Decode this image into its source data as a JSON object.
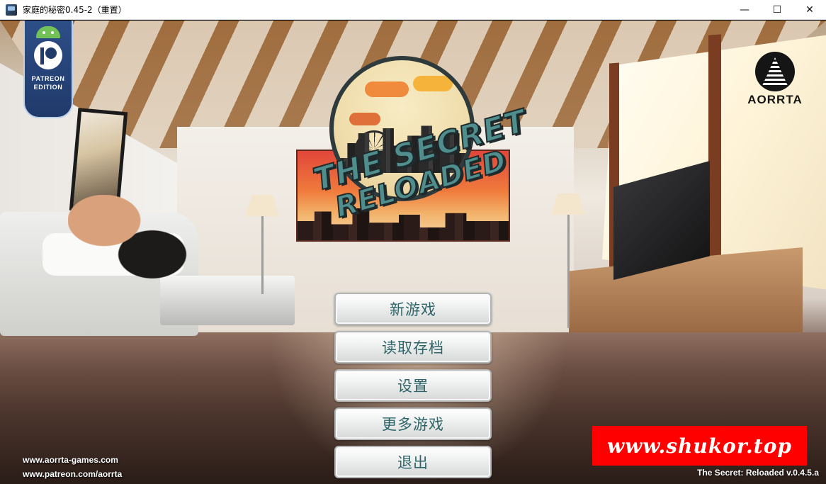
{
  "window": {
    "title": "家庭的秘密0.45-2（重置）",
    "controls": {
      "minimize": "—",
      "maximize": "☐",
      "close": "✕"
    }
  },
  "badges": {
    "patreon_line1": "PATREON",
    "patreon_line2": "EDITION",
    "publisher": "AORRTA"
  },
  "logo": {
    "line1": "THE SECRET",
    "line2": "RELOADED"
  },
  "menu": {
    "items": [
      {
        "label": "新游戏"
      },
      {
        "label": "读取存档"
      },
      {
        "label": "设置"
      },
      {
        "label": "更多游戏"
      },
      {
        "label": "退出"
      }
    ]
  },
  "footer": {
    "site1": "www.aorrta-games.com",
    "site2": "www.patreon.com/aorrta",
    "watermark": "www.shukor.top",
    "version": "The Secret: Reloaded v.0.4.5.a"
  },
  "colors": {
    "menu_text": "#2e6468",
    "patreon_blue": "#203a6a",
    "watermark_red": "#ff0000"
  }
}
